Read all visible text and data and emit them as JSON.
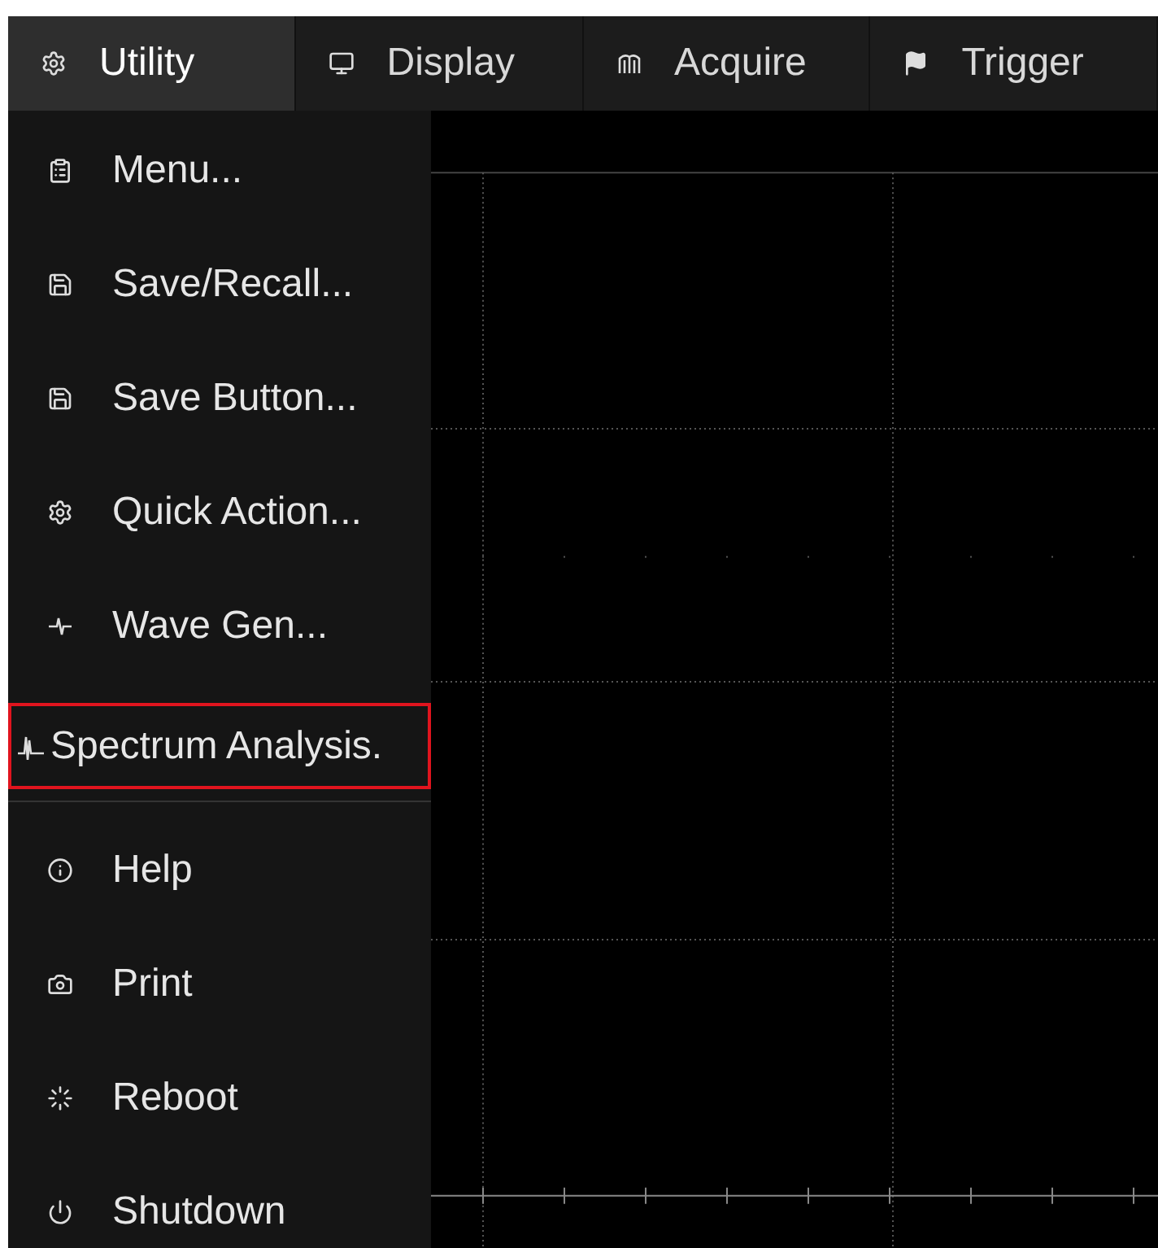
{
  "tabs": [
    {
      "label": "Utility",
      "selected": true
    },
    {
      "label": "Display",
      "selected": false
    },
    {
      "label": "Acquire",
      "selected": false
    },
    {
      "label": "Trigger",
      "selected": false
    }
  ],
  "menu": {
    "sections": [
      [
        {
          "label": "Menu...",
          "selected": false
        },
        {
          "label": "Save/Recall...",
          "selected": false
        },
        {
          "label": "Save Button...",
          "selected": false
        },
        {
          "label": "Quick Action...",
          "selected": false
        },
        {
          "label": "Wave Gen...",
          "selected": false
        },
        {
          "label": "Spectrum Analysis.",
          "selected": true
        }
      ],
      [
        {
          "label": "Help",
          "selected": false
        },
        {
          "label": "Print",
          "selected": false
        },
        {
          "label": "Reboot",
          "selected": false
        },
        {
          "label": "Shutdown",
          "selected": false
        }
      ]
    ]
  }
}
